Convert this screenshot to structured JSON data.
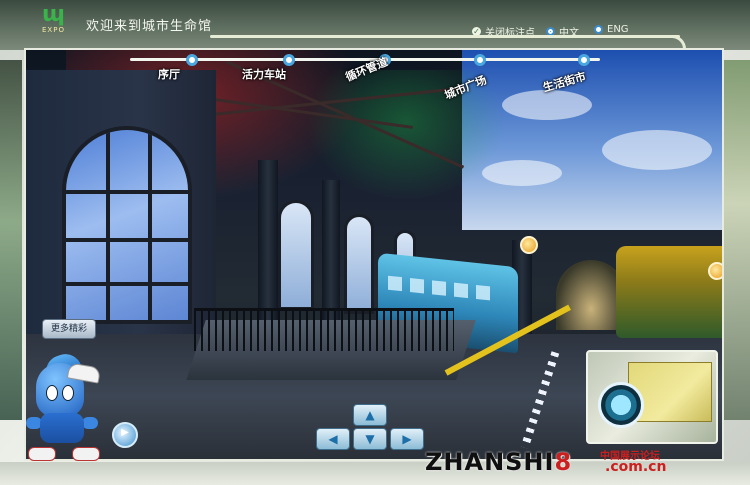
{
  "header": {
    "logo_text": "EXPO",
    "welcome": "欢迎来到城市生命馆",
    "options": [
      {
        "label": "关闭标注点",
        "state": "checked"
      },
      {
        "label": "中文",
        "state": "selected"
      },
      {
        "label": "ENG",
        "state": "unselected"
      }
    ]
  },
  "nav": {
    "items": [
      {
        "label": "序厅"
      },
      {
        "label": "活力车站"
      },
      {
        "label": "循环管道"
      },
      {
        "label": "城市广场"
      },
      {
        "label": "生活街市"
      }
    ]
  },
  "controls": {
    "more_label": "更多精彩",
    "dpad": {
      "up": "▲",
      "left": "◀",
      "down": "▼",
      "right": "▶"
    },
    "play": "▶"
  },
  "watermark": {
    "brand_left": "ZHANSHI",
    "brand_number": "8",
    "sub": "中国展示论坛",
    "domain": ".com.cn"
  },
  "colors": {
    "accent": "#4aa6de",
    "frame": "#e6ecd6",
    "watermark_red": "#cc1f1f"
  }
}
